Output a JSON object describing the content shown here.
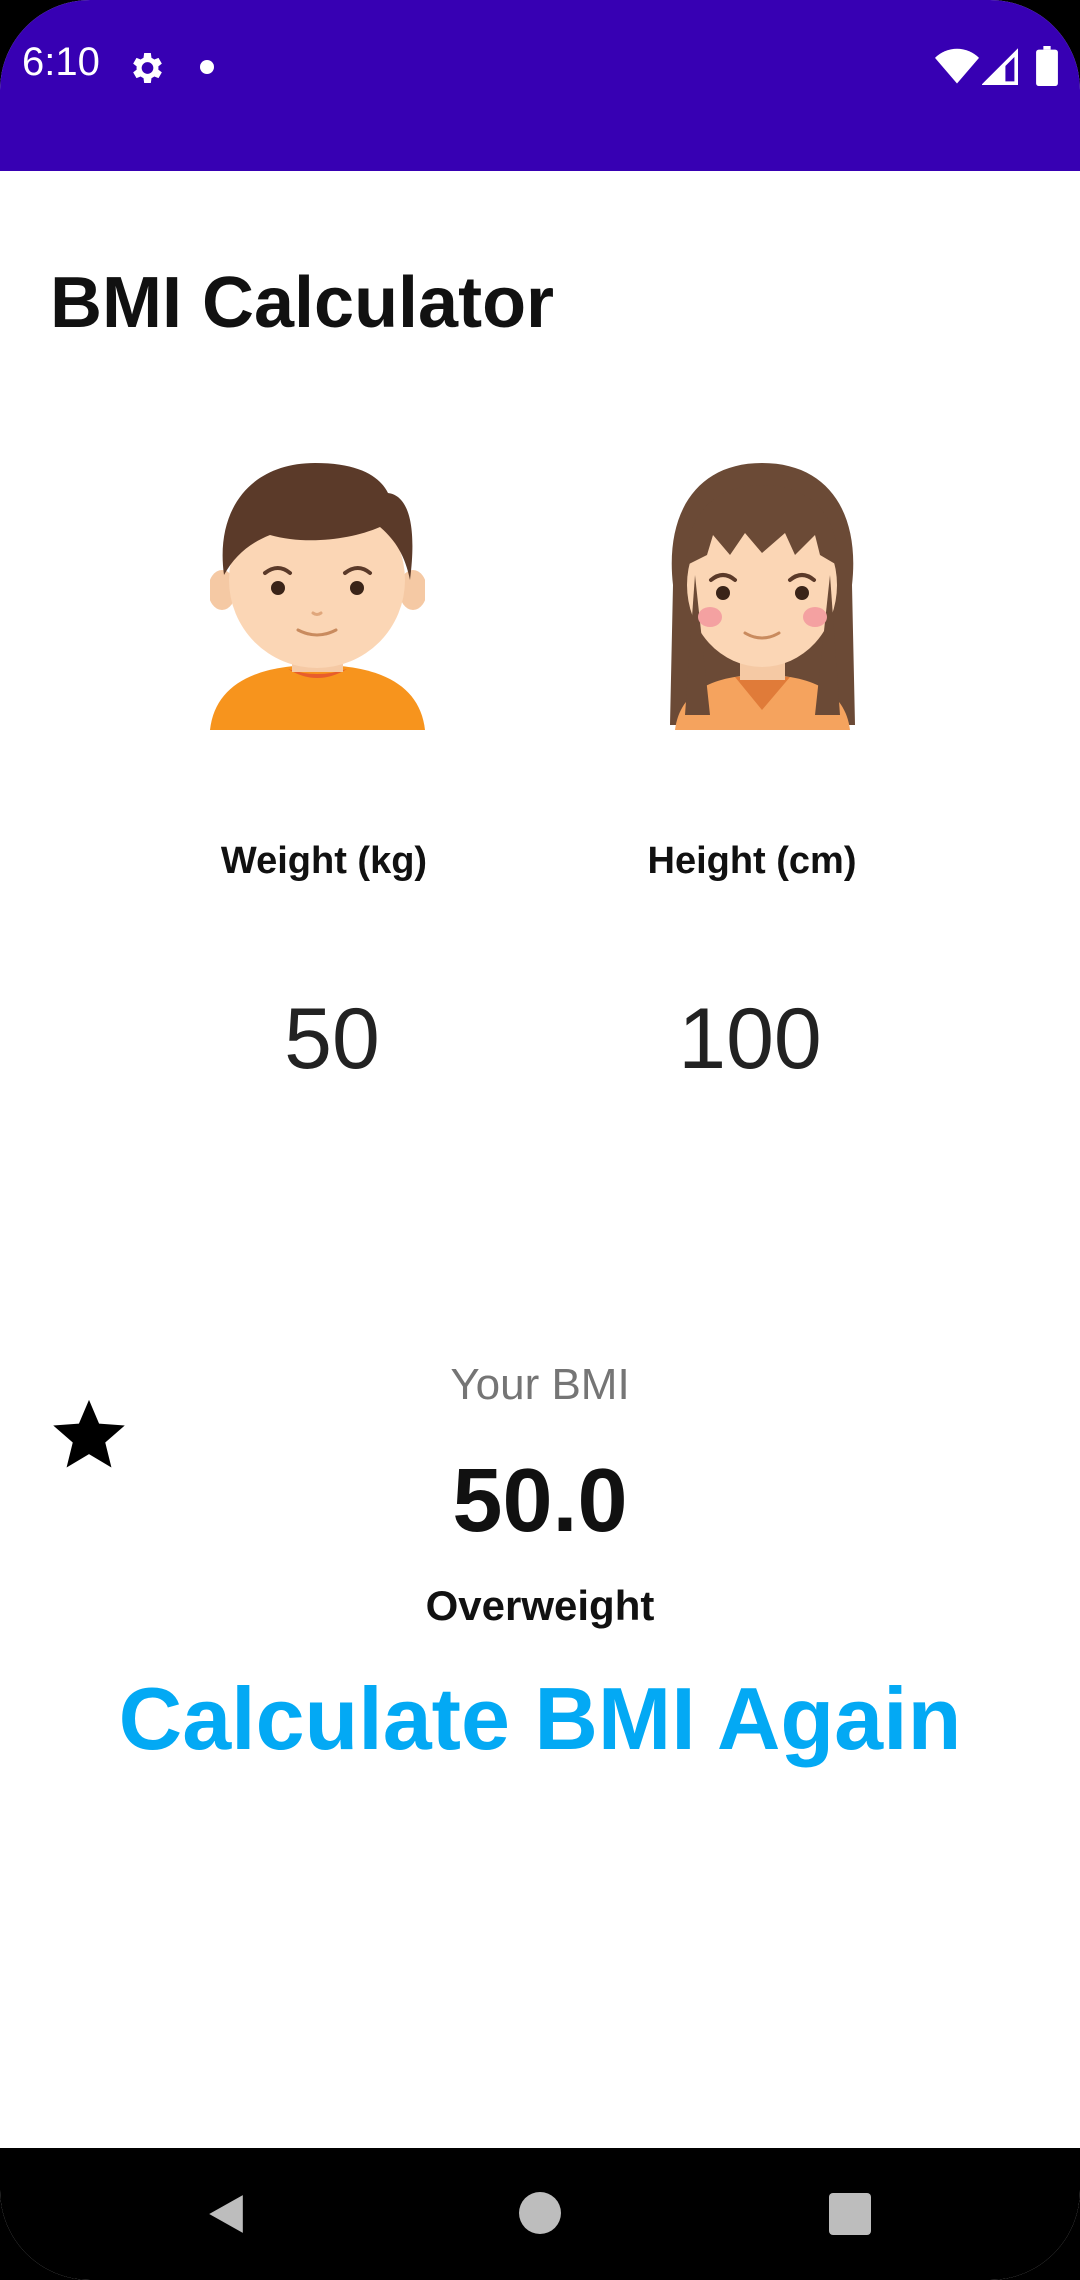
{
  "status_bar": {
    "time": "6:10",
    "icons": [
      "gear-icon",
      "notification-dot-icon",
      "wifi-icon",
      "signal-icon",
      "battery-icon"
    ],
    "background": "#3700b3"
  },
  "app": {
    "title": "BMI Calculator",
    "avatars": [
      "boy-avatar-icon",
      "girl-avatar-icon"
    ],
    "weight": {
      "label": "Weight (kg)",
      "value": "50"
    },
    "height": {
      "label": "Height (cm)",
      "value": "100"
    },
    "result": {
      "caption": "Your BMI",
      "value": "50.0",
      "category": "Overweight",
      "icon": "star-icon"
    },
    "recalculate_label": "Calculate BMI Again",
    "accent_color": "#03a9f4"
  },
  "nav_bar": {
    "icons": [
      "back-icon",
      "home-icon",
      "recents-icon"
    ]
  }
}
